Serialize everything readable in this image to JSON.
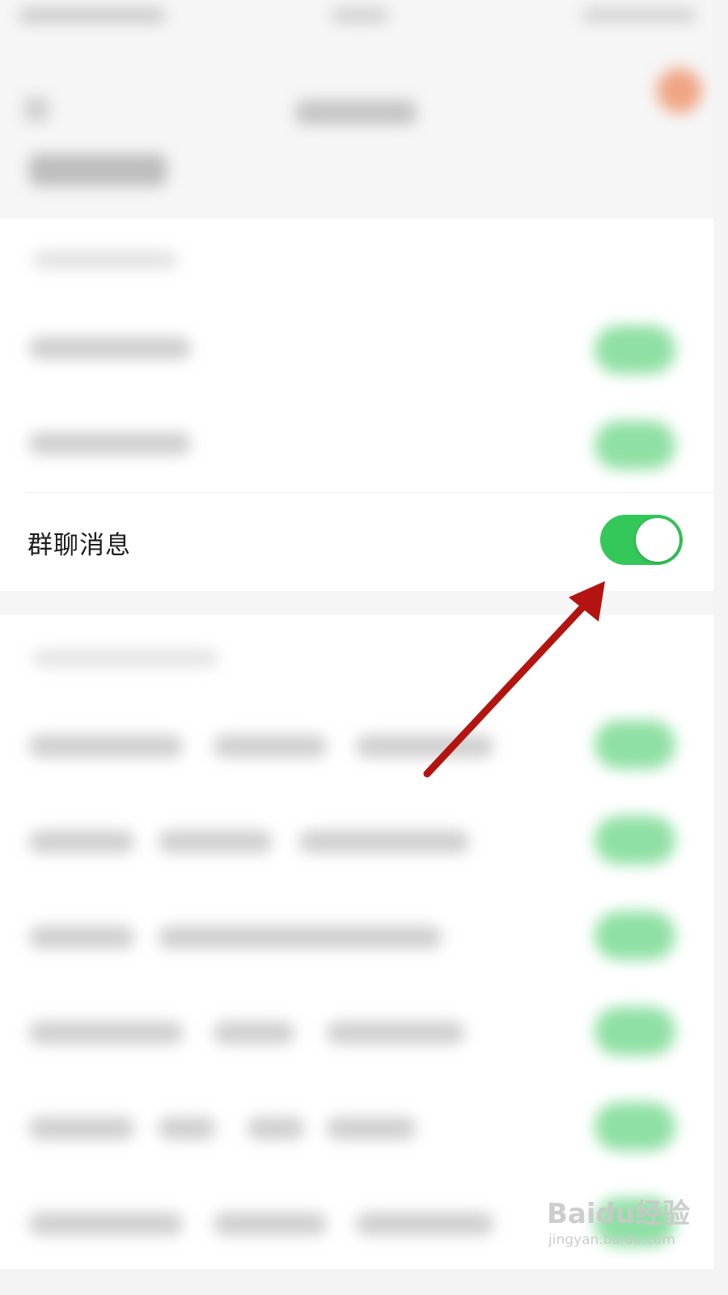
{
  "setting_row": {
    "label": "群聊消息",
    "toggle_on": true,
    "toggle_color": "#34c759"
  },
  "annotation": {
    "arrow_color": "#b3140f"
  },
  "watermark": {
    "logo": "Baidu经验",
    "url": "jingyan.baidu.com"
  }
}
